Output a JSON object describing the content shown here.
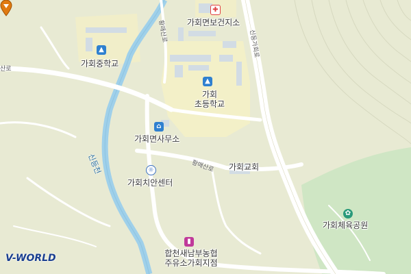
{
  "labels": {
    "health_center": "가회면보건지소",
    "middle_school": "가회중학교",
    "elementary_school_line1": "가회",
    "elementary_school_line2": "초등학교",
    "township_office": "가회면사무소",
    "church": "가회교회",
    "police_center": "가회치안센터",
    "sports_park": "가회체육공원",
    "gas_station_line1": "합천새남부농협",
    "gas_station_line2": "주유소가회지점"
  },
  "roads": {
    "hwangmae_north": "황매산로",
    "hwangmae_south": "황매산로",
    "sindeunggahoe": "신등가회로",
    "west_edge": "산로"
  },
  "water": {
    "stream": "신등천"
  },
  "icons": {
    "health_center": "hospital-icon",
    "middle_school": "school-icon",
    "elementary_school": "school-icon",
    "township_office": "government-office-icon",
    "police_center": "police-icon",
    "sports_park": "park-icon",
    "gas_station": "fuel-icon",
    "location_marker": "location-pin-icon"
  },
  "logo": {
    "text": "V-WORLD"
  },
  "colors": {
    "land": "#e8ead3",
    "water": "#9fd0ea",
    "park": "#cfe6c4",
    "school_area": "#f3f0c8",
    "road": "#ffffff",
    "marker": "#e07a10"
  }
}
